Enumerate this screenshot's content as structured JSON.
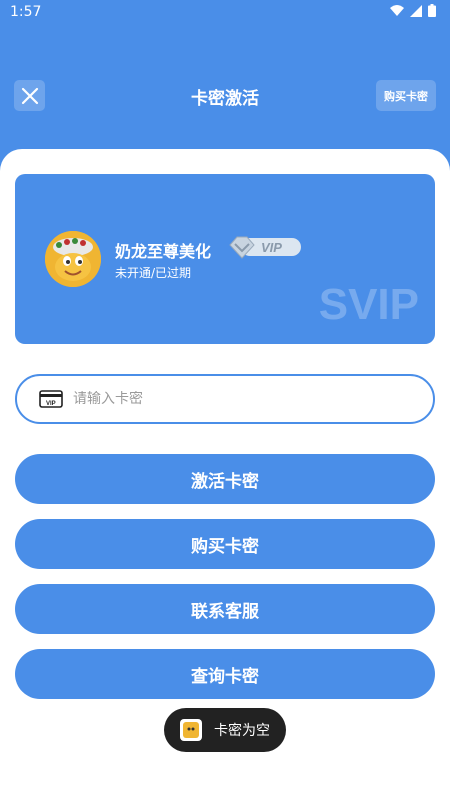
{
  "status_bar": {
    "time": "1:57"
  },
  "header": {
    "title": "卡密激活",
    "buy_label": "购买卡密"
  },
  "vip_card": {
    "name": "奶龙至尊美化",
    "status": "未开通/已过期",
    "badge": "VIP",
    "watermark": "SVIP"
  },
  "input": {
    "placeholder": "请输入卡密",
    "value": ""
  },
  "buttons": {
    "activate": "激活卡密",
    "buy": "购买卡密",
    "contact": "联系客服",
    "query": "查询卡密"
  },
  "toast": {
    "message": "卡密为空"
  },
  "colors": {
    "accent": "#4a8ee8",
    "background": "#ffffff",
    "toast": "#222222"
  }
}
